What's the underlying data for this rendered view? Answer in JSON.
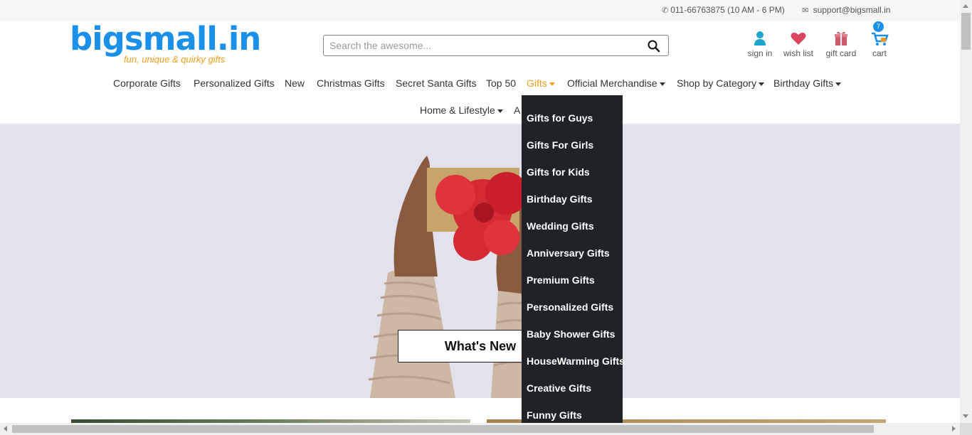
{
  "topbar": {
    "phone": "011-66763875 (10 AM - 6 PM)",
    "email": "support@bigsmall.in"
  },
  "logo": {
    "name": "bigsmall.in",
    "tagline": "fun, unique & quirky gifts"
  },
  "search": {
    "placeholder": "Search the awesome..."
  },
  "header_links": {
    "signin": "sign in",
    "wishlist": "wish list",
    "giftcard": "gift card",
    "cart": "cart",
    "cart_count": "7"
  },
  "nav": {
    "items": [
      "Corporate Gifts",
      "Personalized Gifts",
      "New",
      "Christmas Gifts",
      "Secret Santa Gifts",
      "Top 50",
      "Gifts",
      "Official Merchandise",
      "Shop by Category",
      "Birthday Gifts",
      "Home & Lifestyle",
      "A"
    ]
  },
  "gifts_menu": {
    "items": [
      "Gifts for Guys",
      "Gifts For Girls",
      "Gifts for Kids",
      "Birthday Gifts",
      "Wedding Gifts",
      "Anniversary Gifts",
      "Premium Gifts",
      "Personalized Gifts",
      "Baby Shower Gifts",
      "HouseWarming Gifts",
      "Creative Gifts",
      "Funny Gifts"
    ]
  },
  "hero": {
    "button": "What's New"
  },
  "colors": {
    "brand_blue": "#1a90e8",
    "brand_orange": "#f39b1f",
    "dropdown_bg": "#1f2327",
    "hero_bg": "#e2e0ea"
  },
  "icons": {
    "phone": "phone-icon",
    "email": "envelope-icon",
    "search": "search-icon",
    "signin": "user-icon",
    "wishlist": "heart-icon",
    "giftcard": "gift-icon",
    "cart": "cart-icon"
  }
}
